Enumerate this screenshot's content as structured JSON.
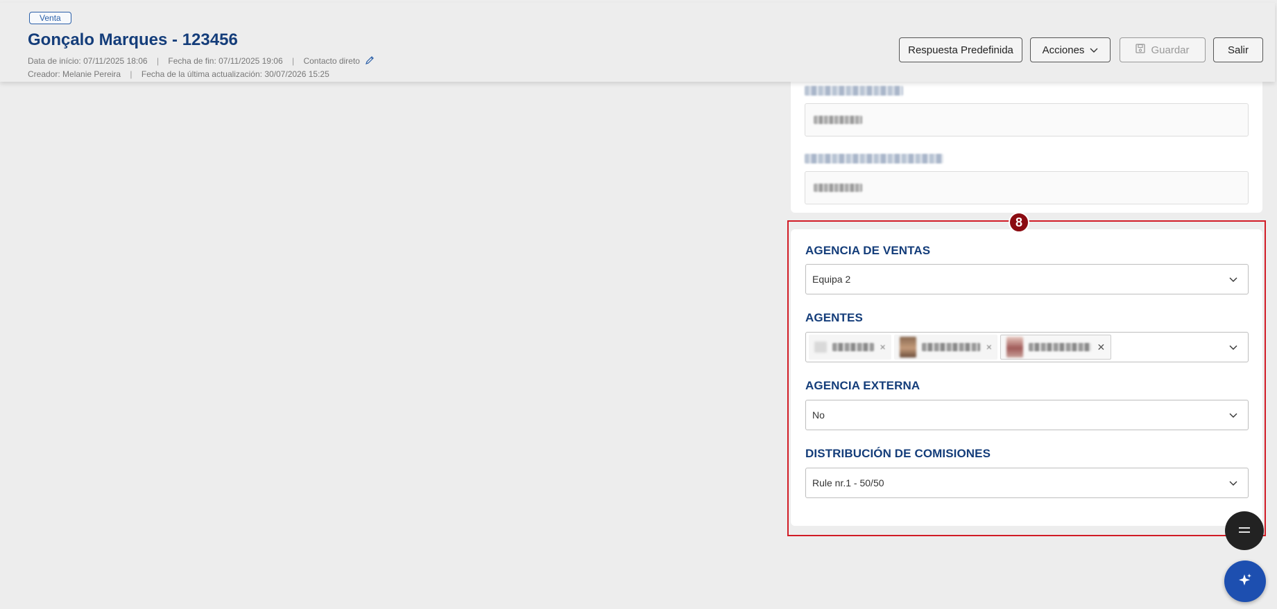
{
  "header": {
    "badge": "Venta",
    "title": "Gonçalo Marques - 123456",
    "start_label": "Data de início:",
    "start_value": "07/11/2025 18:06",
    "end_label": "Fecha de fin:",
    "end_value": "07/11/2025 19:06",
    "contact": "Contacto direto",
    "creator_label": "Creador:",
    "creator_value": "Melanie Pereira",
    "updated_label": "Fecha de la última actualización:",
    "updated_value": "30/07/2026 15:25",
    "separator": "|"
  },
  "toolbar": {
    "predefined": "Respuesta Predefinida",
    "actions": "Acciones",
    "save": "Guardar",
    "exit": "Salir"
  },
  "step": "8",
  "form": {
    "sales_agency_label": "AGENCIA DE VENTAS",
    "sales_agency_value": "Equipa 2",
    "agents_label": "AGENTES",
    "external_agency_label": "AGENCIA EXTERNA",
    "external_agency_value": "No",
    "commission_label": "DISTRIBUCIÓN DE COMISIONES",
    "commission_value": "Rule nr.1 - 50/50"
  },
  "icons": {
    "pencil": "pencil-icon",
    "chevron": "chevron-down-icon",
    "save": "floppy-disk-icon",
    "menu": "menu-icon",
    "ai": "sparkle-icon"
  },
  "colors": {
    "title": "#143d7a",
    "highlight": "#d11b25",
    "step_badge": "#8b0c12",
    "fab_ai": "#1d4fb0"
  }
}
